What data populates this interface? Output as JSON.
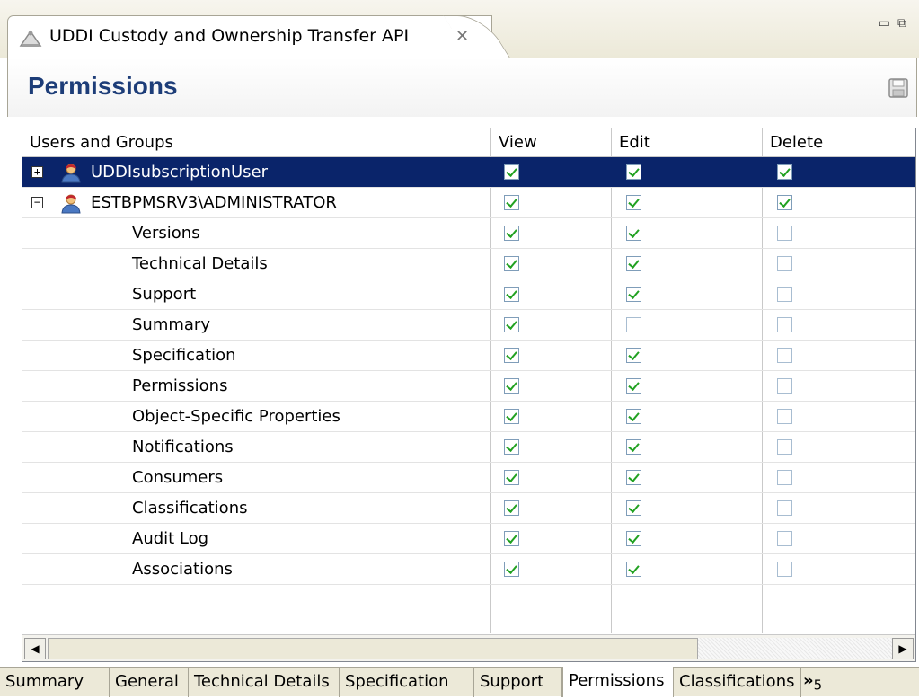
{
  "editor_tab": {
    "title": "UDDI Custody and Ownership Transfer API",
    "close_glyph": "✕"
  },
  "form": {
    "title": "Permissions"
  },
  "grid": {
    "columns": [
      "Users and Groups",
      "View",
      "Edit",
      "Delete"
    ],
    "rows": [
      {
        "name": "UDDIsubscriptionUser",
        "type": "user",
        "expander": "+",
        "selected": true,
        "view": true,
        "edit": true,
        "delete": true
      },
      {
        "name": "ESTBPMSRV3\\ADMINISTRATOR",
        "type": "user",
        "expander": "−",
        "selected": false,
        "view": true,
        "edit": true,
        "delete": true
      },
      {
        "name": "Versions",
        "type": "child",
        "view": true,
        "edit": true,
        "delete": false
      },
      {
        "name": "Technical Details",
        "type": "child",
        "view": true,
        "edit": true,
        "delete": false
      },
      {
        "name": "Support",
        "type": "child",
        "view": true,
        "edit": true,
        "delete": false
      },
      {
        "name": "Summary",
        "type": "child",
        "view": true,
        "edit": false,
        "delete": false
      },
      {
        "name": "Specification",
        "type": "child",
        "view": true,
        "edit": true,
        "delete": false
      },
      {
        "name": "Permissions",
        "type": "child",
        "view": true,
        "edit": true,
        "delete": false
      },
      {
        "name": "Object-Specific Properties",
        "type": "child",
        "view": true,
        "edit": true,
        "delete": false
      },
      {
        "name": "Notifications",
        "type": "child",
        "view": true,
        "edit": true,
        "delete": false
      },
      {
        "name": "Consumers",
        "type": "child",
        "view": true,
        "edit": true,
        "delete": false
      },
      {
        "name": "Classifications",
        "type": "child",
        "view": true,
        "edit": true,
        "delete": false
      },
      {
        "name": "Audit Log",
        "type": "child",
        "view": true,
        "edit": true,
        "delete": false
      },
      {
        "name": "Associations",
        "type": "child",
        "view": true,
        "edit": true,
        "delete": false
      }
    ]
  },
  "bottom_tabs": [
    {
      "label": "Summary",
      "active": false
    },
    {
      "label": "General",
      "active": false
    },
    {
      "label": "Technical Details",
      "active": false
    },
    {
      "label": "Specification",
      "active": false
    },
    {
      "label": "Support",
      "active": false
    },
    {
      "label": "Permissions",
      "active": true
    },
    {
      "label": "Classifications",
      "active": false
    }
  ],
  "more_tabs": {
    "glyph": "»",
    "count": "5"
  },
  "colors": {
    "selection": "#0a246a",
    "title": "#1d3d78",
    "check": "#21a121"
  },
  "icons": {
    "editor_tab": "api-service-icon",
    "save": "save-icon",
    "user": "user-icon"
  }
}
